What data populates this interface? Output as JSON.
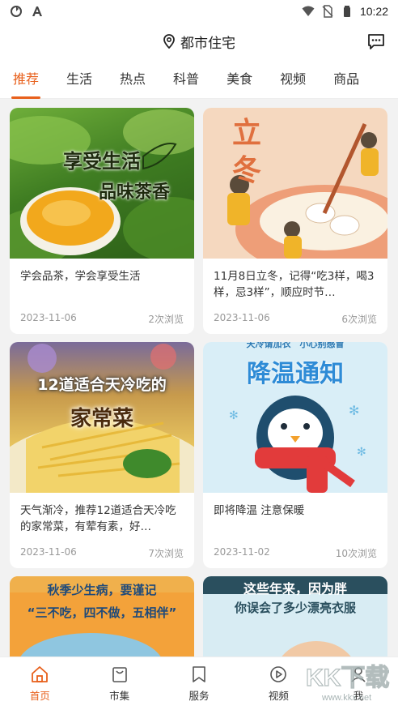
{
  "status_bar": {
    "time": "10:22"
  },
  "header": {
    "location": "都市住宅"
  },
  "tabs": [
    {
      "label": "推荐",
      "active": true
    },
    {
      "label": "生活"
    },
    {
      "label": "热点"
    },
    {
      "label": "科普"
    },
    {
      "label": "美食"
    },
    {
      "label": "视频"
    },
    {
      "label": "商品"
    }
  ],
  "cards": [
    {
      "id": "tea",
      "image_text": [
        "享受生活",
        "品味茶香"
      ],
      "title": "学会品茶，学会享受生活",
      "date": "2023-11-06",
      "views": "2次浏览"
    },
    {
      "id": "lidong",
      "image_text": [
        "立",
        "冬"
      ],
      "title": "11月8日立冬，记得“吃3样，喝3样，忌3样”，顺应时节…",
      "date": "2023-11-06",
      "views": "6次浏览"
    },
    {
      "id": "dishes",
      "image_text": [
        "12道适合天冷吃的",
        "家常菜"
      ],
      "title": "天气渐冷，推荐12道适合天冷吃的家常菜，有荤有素，好…",
      "date": "2023-11-06",
      "views": "7次浏览"
    },
    {
      "id": "cooling",
      "image_text": [
        "天冷请加衣　小心别感冒",
        "降温通知"
      ],
      "title": "即将降温 注意保暖",
      "date": "2023-11-02",
      "views": "10次浏览"
    },
    {
      "id": "autumn",
      "image_text": [
        "秋季少生病，要谨记",
        "“三不吃，四不做，五相伴”"
      ]
    },
    {
      "id": "clothes",
      "image_text": [
        "这些年来，因为胖",
        "你误会了多少漂亮衣服"
      ]
    }
  ],
  "bottom_nav": [
    {
      "label": "首页",
      "icon": "home-icon",
      "active": true
    },
    {
      "label": "市集",
      "icon": "shopping-bag-icon"
    },
    {
      "label": "服务",
      "icon": "bookmark-icon"
    },
    {
      "label": "视频",
      "icon": "play-circle-icon"
    },
    {
      "label": "我",
      "icon": "user-icon"
    }
  ],
  "watermark": {
    "text": "KK下载",
    "url": "www.kkx.net"
  },
  "colors": {
    "accent": "#e8601c",
    "background": "#f2f2f2",
    "meta_text": "#999999"
  }
}
